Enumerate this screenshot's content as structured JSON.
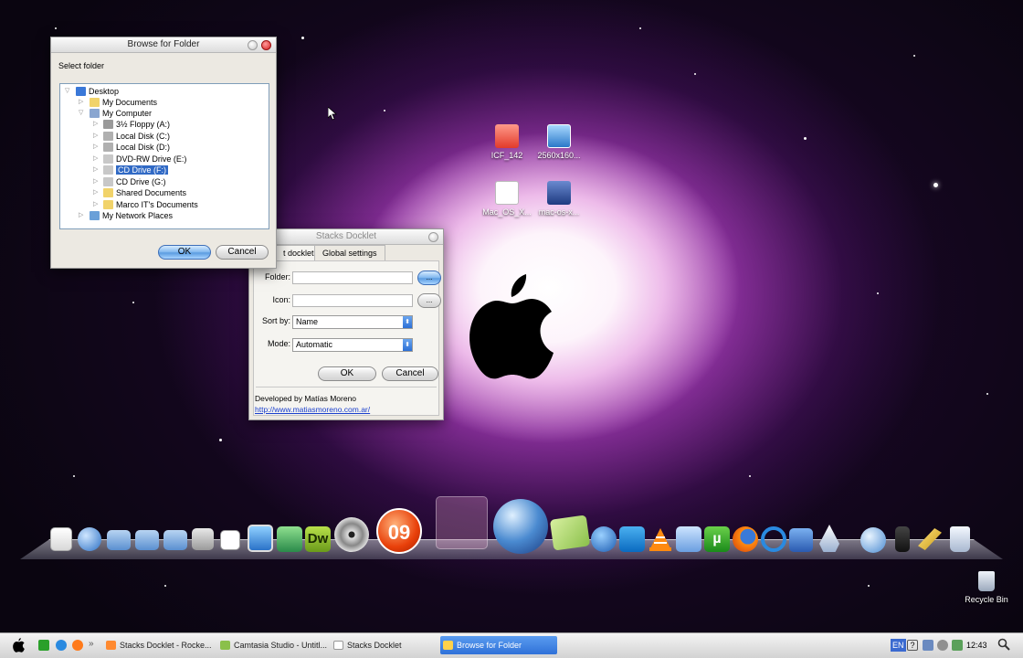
{
  "desktop": {
    "icons": [
      {
        "label": "ICF_142",
        "icon": "folder-icon"
      },
      {
        "label": "2560x160...",
        "icon": "image-file-icon"
      },
      {
        "label": "Mac_OS_X...",
        "icon": "document-icon"
      },
      {
        "label": "mac-os-x...",
        "icon": "installer-icon"
      }
    ],
    "recycle_bin_label": "Recycle Bin"
  },
  "browse_dialog": {
    "title": "Browse for Folder",
    "prompt": "Select folder",
    "tree": [
      {
        "label": "Desktop",
        "icon": "desktop-icon"
      },
      {
        "label": "My Documents",
        "icon": "documents-folder-icon"
      },
      {
        "label": "My Computer",
        "icon": "computer-icon"
      },
      {
        "label": "3½ Floppy (A:)",
        "icon": "floppy-drive-icon"
      },
      {
        "label": "Local Disk (C:)",
        "icon": "hard-disk-icon"
      },
      {
        "label": "Local Disk (D:)",
        "icon": "hard-disk-icon"
      },
      {
        "label": "DVD-RW Drive (E:)",
        "icon": "dvd-drive-icon"
      },
      {
        "label": "CD Drive (F:)",
        "icon": "cd-drive-icon",
        "selected": true
      },
      {
        "label": "CD Drive (G:)",
        "icon": "cd-drive-icon"
      },
      {
        "label": "Shared Documents",
        "icon": "folder-icon"
      },
      {
        "label": "Marco  IT's Documents",
        "icon": "folder-icon"
      },
      {
        "label": "My Network Places",
        "icon": "network-icon"
      }
    ],
    "ok_label": "OK",
    "cancel_label": "Cancel"
  },
  "stacks_docklet": {
    "title": "Stacks Docklet",
    "tabs": [
      {
        "label": "t docklet",
        "active": true
      },
      {
        "label": "Global settings",
        "active": false
      }
    ],
    "folder_label": "Folder:",
    "folder_value": "",
    "icon_label": "Icon:",
    "icon_value": "",
    "browse_label": "...",
    "sort_label": "Sort by:",
    "sort_value": "Name",
    "mode_label": "Mode:",
    "mode_value": "Automatic",
    "ok_label": "OK",
    "cancel_label": "Cancel",
    "developer": "Developed by Matías Moreno",
    "url": "http://www.matiasmoreno.com.ar/"
  },
  "dock": {
    "badge_text": "09",
    "dreamweaver_label": "Dw",
    "utorrent_label": "µ",
    "items": [
      "notes-icon",
      "globe-icon",
      "folder-icon",
      "folder-icon",
      "folder-icon",
      "tools-icon",
      "calendar-icon",
      "photo-icon",
      "puzzle-icon",
      "dreamweaver-icon",
      "dvd-icon",
      "nero-icon",
      "empty-slot",
      "vuze-icon",
      "notepad-icon",
      "vuze-alt-icon",
      "teamviewer-icon",
      "vlc-icon",
      "network-icon",
      "utorrent-icon",
      "firefox-icon",
      "ie-icon",
      "tools-icon",
      "rocket-icon",
      "globe-icon",
      "usb-icon",
      "wrench-icon",
      "trash-icon"
    ]
  },
  "taskbar": {
    "tasks": [
      {
        "label": "Stacks Docklet - Rocke...",
        "active": false
      },
      {
        "label": "Camtasia Studio - Untitl...",
        "active": false
      },
      {
        "label": "Stacks Docklet",
        "active": false
      },
      {
        "label": "Browse for Folder",
        "active": true
      }
    ],
    "language": "EN",
    "clock": "12:43"
  },
  "colors": {
    "selection": "#316ac5",
    "taskbar_active": "#2f71d8",
    "link": "#1a3fcc"
  }
}
